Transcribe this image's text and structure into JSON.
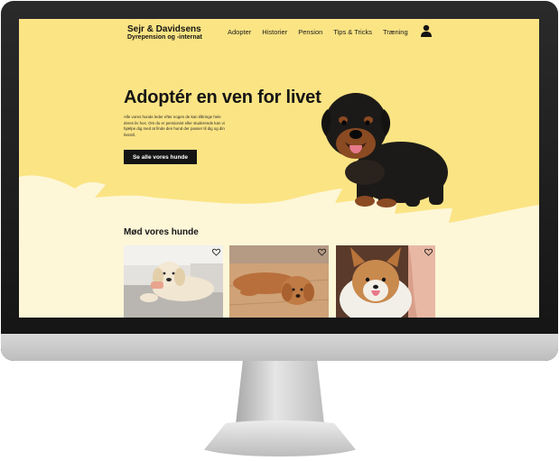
{
  "brand": {
    "name": "Sejr & Davidsens",
    "subtitle": "Dyrepension og -internat"
  },
  "nav": {
    "items": [
      "Adopter",
      "Historier",
      "Pension",
      "Tips & Tricks",
      "Træning"
    ]
  },
  "icons": {
    "user": "user-icon",
    "favorite": "heart-icon"
  },
  "hero": {
    "title": "Adoptér en ven for livet",
    "text": "Alle vores hunde leder efter nogen de kan tilbringe hele deres liv hos. Om du er pensionist eller studerende kan vi hjælpe dig med at finde den hund der passer til dig og din livsstil.",
    "cta_label": "Se alle vores hunde"
  },
  "dogs_section": {
    "title": "Mød vores hunde"
  },
  "colors": {
    "accent": "#fbe484",
    "light": "#fdf7d8",
    "dark": "#141414"
  }
}
